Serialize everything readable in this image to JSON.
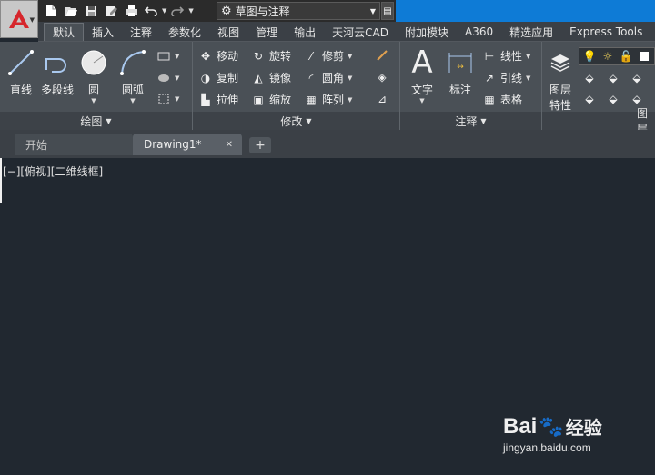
{
  "title_bar": {
    "workspace": "草图与注释",
    "qat_icons": [
      "new-icon",
      "open-icon",
      "save-icon",
      "saveas-icon",
      "print-icon",
      "undo-icon",
      "redo-icon"
    ]
  },
  "ribbon_tabs": [
    "默认",
    "插入",
    "注释",
    "参数化",
    "视图",
    "管理",
    "输出",
    "天河云CAD",
    "附加模块",
    "A360",
    "精选应用",
    "Express Tools"
  ],
  "panels": {
    "draw": {
      "title": "绘图",
      "tools": [
        "直线",
        "多段线",
        "圆",
        "圆弧"
      ]
    },
    "modify": {
      "title": "修改",
      "tools": [
        "移动",
        "旋转",
        "修剪",
        "复制",
        "镜像",
        "圆角",
        "拉伸",
        "缩放",
        "阵列"
      ]
    },
    "annotation": {
      "title": "注释",
      "tools": [
        "文字",
        "标注",
        "线性",
        "引线",
        "表格"
      ]
    },
    "layers": {
      "title": "图层",
      "tools": [
        "图层",
        "特性"
      ]
    }
  },
  "doc_tabs": {
    "start": "开始",
    "drawing": "Drawing1*"
  },
  "viewport": {
    "label": "[−][俯视][二维线框]"
  },
  "watermark": {
    "brand": "Bai",
    "brand2": "经验",
    "url": "jingyan.baidu.com"
  },
  "colors": {
    "accent": "#0e7bd6",
    "canvas": "#212830",
    "ribbon": "#4a5056"
  }
}
